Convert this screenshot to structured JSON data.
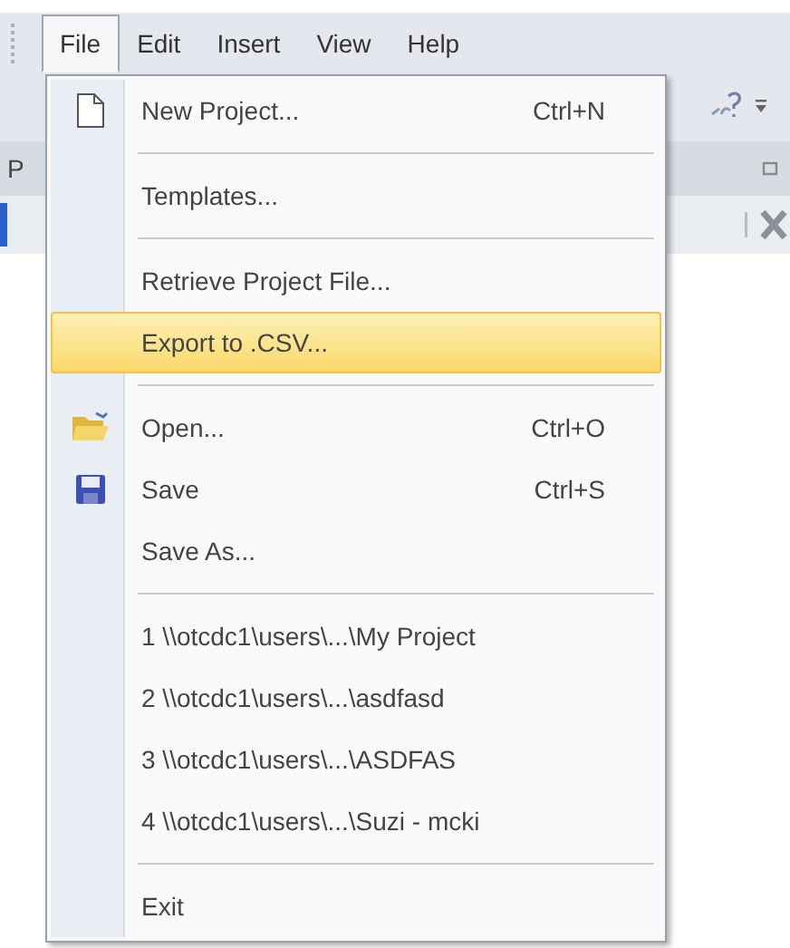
{
  "menubar": [
    {
      "label": "File",
      "selected": true
    },
    {
      "label": "Edit",
      "selected": false
    },
    {
      "label": "Insert",
      "selected": false
    },
    {
      "label": "View",
      "selected": false
    },
    {
      "label": "Help",
      "selected": false
    }
  ],
  "background": {
    "panel_title": "P"
  },
  "menu": [
    {
      "kind": "item",
      "label": "New Project...",
      "shortcut": "Ctrl+N",
      "selected": false
    },
    {
      "kind": "separator"
    },
    {
      "kind": "item",
      "label": "Templates...",
      "selected": false
    },
    {
      "kind": "separator"
    },
    {
      "kind": "item",
      "label": "Retrieve Project File...",
      "selected": false
    },
    {
      "kind": "item",
      "label": "Export to .CSV...",
      "selected": true
    },
    {
      "kind": "separator"
    },
    {
      "kind": "item",
      "label": "Open...",
      "shortcut": "Ctrl+O",
      "selected": false
    },
    {
      "kind": "item",
      "label": "Save",
      "shortcut": "Ctrl+S",
      "selected": false
    },
    {
      "kind": "item",
      "label": "Save As...",
      "selected": false
    },
    {
      "kind": "separator"
    },
    {
      "kind": "item",
      "label": "1 \\\\otcdc1\\users\\...\\My Project",
      "selected": false
    },
    {
      "kind": "item",
      "label": "2 \\\\otcdc1\\users\\...\\asdfasd",
      "selected": false
    },
    {
      "kind": "item",
      "label": "3 \\\\otcdc1\\users\\...\\ASDFAS",
      "selected": false
    },
    {
      "kind": "item",
      "label": "4 \\\\otcdc1\\users\\...\\Suzi - mcki",
      "selected": false
    },
    {
      "kind": "separator"
    },
    {
      "kind": "item",
      "label": "Exit",
      "selected": false
    }
  ]
}
